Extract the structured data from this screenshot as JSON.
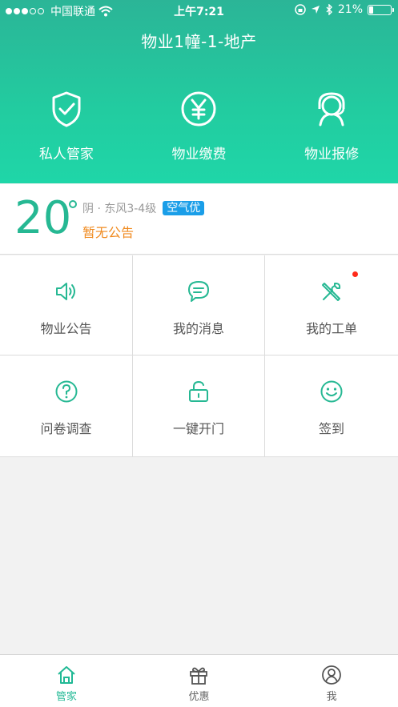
{
  "status": {
    "carrier": "中国联通",
    "time": "上午7:21",
    "battery": "21%",
    "battery_level": 0.21,
    "signal_bars_filled": 3,
    "signal_bars_total": 5
  },
  "header": {
    "title": "物业1幢-1-地产",
    "actions": [
      {
        "label": "私人管家",
        "icon": "shield-check-icon"
      },
      {
        "label": "物业缴费",
        "icon": "yen-circle-icon"
      },
      {
        "label": "物业报修",
        "icon": "support-agent-icon"
      }
    ]
  },
  "weather": {
    "temperature": "20",
    "description": "阴 · 东风3-4级",
    "air_quality": "空气优",
    "notice": "暂无公告"
  },
  "grid": {
    "items": [
      {
        "label": "物业公告",
        "icon": "speaker-icon"
      },
      {
        "label": "我的消息",
        "icon": "message-icon"
      },
      {
        "label": "我的工单",
        "icon": "tools-icon",
        "has_badge": true
      },
      {
        "label": "问卷调查",
        "icon": "question-icon"
      },
      {
        "label": "一键开门",
        "icon": "unlock-icon"
      },
      {
        "label": "签到",
        "icon": "smile-icon"
      }
    ]
  },
  "tabs": [
    {
      "label": "管家",
      "icon": "home-icon",
      "active": true
    },
    {
      "label": "优惠",
      "icon": "gift-icon",
      "active": false
    },
    {
      "label": "我",
      "icon": "user-icon",
      "active": false
    }
  ],
  "colors": {
    "accent": "#26b893",
    "notice": "#f08a1e",
    "aqi_badge": "#1a9ee8",
    "badge_dot": "#ff2a1a"
  }
}
